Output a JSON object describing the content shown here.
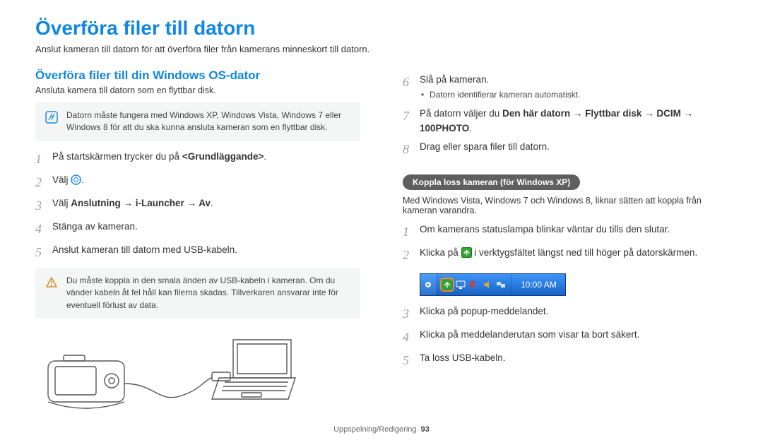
{
  "title": "Överföra filer till datorn",
  "intro": "Anslut kameran till datorn för att överföra filer från kamerans minneskort till datorn.",
  "section_header_left": "Överföra filer till din Windows OS-dator",
  "left_sub": "Ansluta kamera till datorn som en flyttbar disk.",
  "note1": "Datorn måste fungera med Windows XP, Windows Vista, Windows 7 eller Windows 8 för att du ska kunna ansluta kameran som en flyttbar disk.",
  "steps_left": {
    "s1_pre": "På startskärmen trycker du på ",
    "s1_bold": "<Grundläggande>",
    "s1_post": ".",
    "s2_pre": "Välj ",
    "s2_post": ".",
    "s3_pre": "Välj ",
    "s3_bold": "Anslutning → i-Launcher → Av",
    "s3_post": ".",
    "s4": "Stänga av kameran.",
    "s5": "Anslut kameran till datorn med USB-kabeln."
  },
  "warn": "Du måste koppla in den smala änden av USB-kabeln i kameran. Om du vänder kabeln åt fel håll kan filerna skadas. Tillverkaren ansvarar inte för eventuell förlust av data.",
  "steps_right": {
    "s6": "Slå på kameran.",
    "s6_sub": "Datorn identifierar kameran automatiskt.",
    "s7_pre": "På datorn väljer du ",
    "s7_bold": "Den här datorn → Flyttbar disk → DCIM → 100PHOTO",
    "s7_post": ".",
    "s8": "Drag eller spara filer till datorn."
  },
  "pill": "Koppla loss kameran (för Windows XP)",
  "pill_after": "Med Windows Vista, Windows 7 och Windows 8, liknar sätten att koppla från kameran varandra.",
  "disc_steps": {
    "s1": "Om kamerans statuslampa blinkar väntar du tills den slutar.",
    "s2_pre": "Klicka på ",
    "s2_post": " i verktygsfältet längst ned till höger på datorskärmen.",
    "s3": "Klicka på popup-meddelandet.",
    "s4": "Klicka på meddelanderutan som visar ta bort säkert.",
    "s5": "Ta loss USB-kabeln."
  },
  "taskbar_time": "10:00 AM",
  "footer_section": "Uppspelning/Redigering",
  "footer_page": "93"
}
